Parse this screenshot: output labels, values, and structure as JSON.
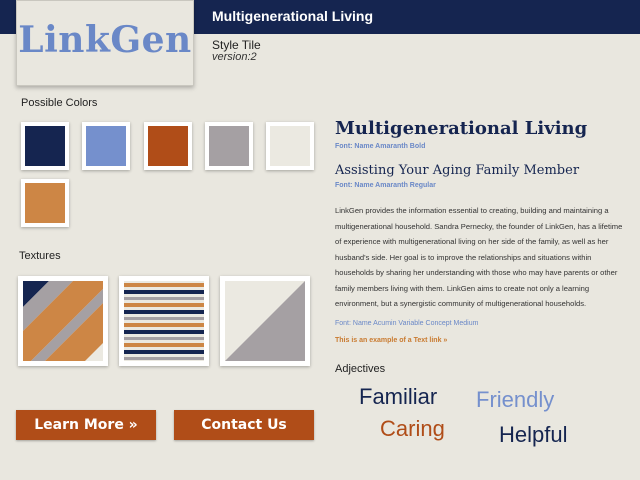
{
  "header": {
    "title": "Multigenerational Living"
  },
  "logo": {
    "text": "LinkGen"
  },
  "tile": {
    "name": "Style Tile",
    "version": "version:2"
  },
  "colors": {
    "label": "Possible Colors",
    "swatches": [
      {
        "name": "navy",
        "hex": "#152550"
      },
      {
        "name": "periwinkle",
        "hex": "#7590cd"
      },
      {
        "name": "rust",
        "hex": "#b04d18"
      },
      {
        "name": "gray",
        "hex": "#a5a0a3"
      },
      {
        "name": "cream",
        "hex": "#ebe9e1"
      },
      {
        "name": "tan",
        "hex": "#cd8645"
      }
    ]
  },
  "textures": {
    "label": "Textures"
  },
  "buttons": {
    "learn_more": "Learn More »",
    "contact_us": "Contact Us",
    "color": "#b04d18"
  },
  "typography": {
    "heading1": "Multigenerational Living",
    "heading1_font": "Font: Name Amaranth Bold",
    "heading2": "Assisting Your Aging Family Member",
    "heading2_font": "Font: Name Amaranth Regular",
    "body": "LinkGen provides the information essential to creating, building and maintaining a multigenerational household. Sandra Pernecky, the founder of LinkGen, has a lifetime of experience with multigenerational living on her side of the family, as well as her husband's side. Her goal is to improve the relationships and situations within households by sharing her understanding with those who may have parents or other family members living with them. LinkGen aims to create not only a learning environment, but a synergistic community of multigenerational households.",
    "body_font": "Font: Name Acumin Variable Concept Medium",
    "link_example": "This is an example of a Text link »"
  },
  "adjectives": {
    "label": "Adjectives",
    "items": [
      {
        "word": "Familiar",
        "color": "#152550"
      },
      {
        "word": "Friendly",
        "color": "#7590cd"
      },
      {
        "word": "Caring",
        "color": "#b04d18"
      },
      {
        "word": "Helpful",
        "color": "#152550"
      }
    ]
  }
}
